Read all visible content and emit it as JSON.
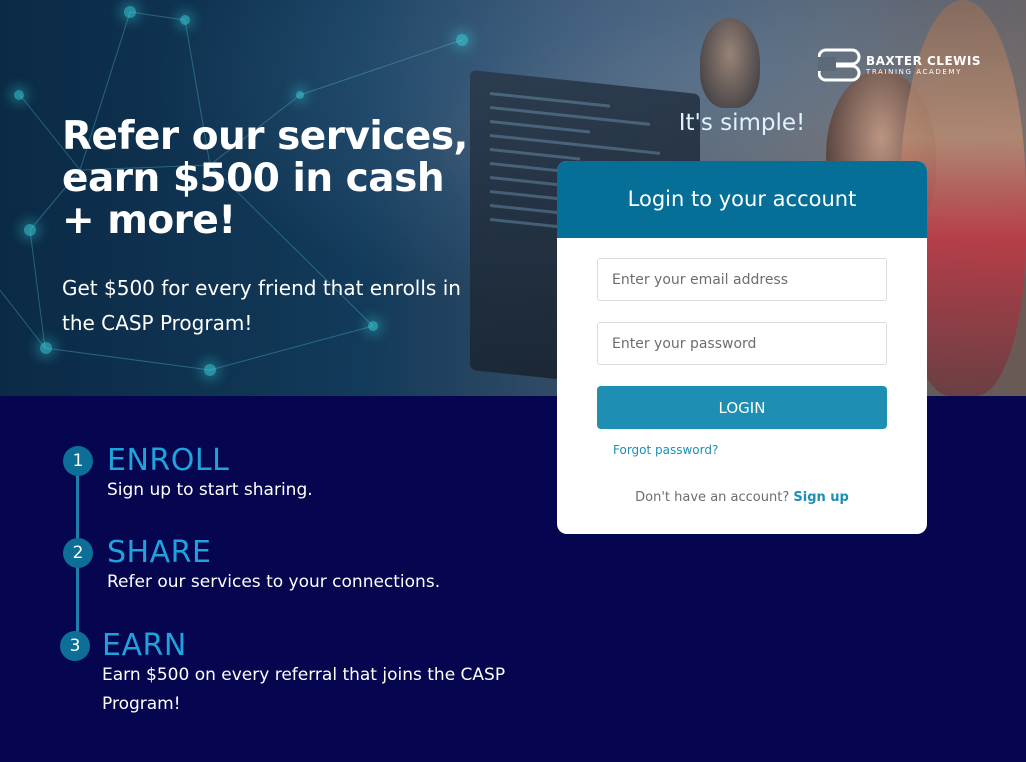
{
  "hero": {
    "headline": "Refer our services, earn $500 in cash + more!",
    "subhead": "Get $500 for every friend that enrolls in the CASP Program!"
  },
  "logo": {
    "name": "BAXTER CLEWIS",
    "subtitle": "TRAINING ACADEMY",
    "icon": "baxter-clewis-logo-icon"
  },
  "tagline": "It's simple!",
  "login": {
    "title": "Login to your account",
    "email_placeholder": "Enter your email address",
    "password_placeholder": "Enter your password",
    "button_label": "LOGIN",
    "forgot_label": "Forgot password?",
    "no_account_text": "Don't have an account?",
    "signup_label": "Sign up"
  },
  "steps": [
    {
      "number": "1",
      "title": "ENROLL",
      "description": "Sign up to start sharing."
    },
    {
      "number": "2",
      "title": "SHARE",
      "description": "Refer our services to your connections."
    },
    {
      "number": "3",
      "title": "EARN",
      "description": "Earn $500 on every referral that joins the CASP Program!"
    }
  ],
  "colors": {
    "background": "#05064f",
    "card_header": "#066f98",
    "button": "#1e8fb3",
    "step_title": "#1fa3dc",
    "step_badge": "#0d6e97"
  }
}
